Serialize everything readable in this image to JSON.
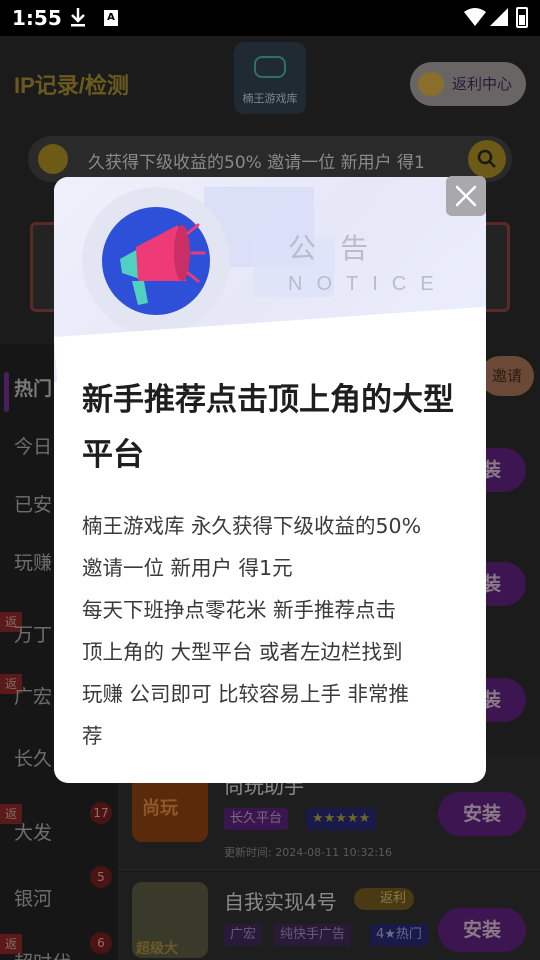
{
  "status_bar": {
    "time": "1:55"
  },
  "header": {
    "title": "IP记录/检测",
    "logo_text": "楠王游戏库",
    "rebate_button": "返利中心"
  },
  "ticker": {
    "text": "久获得下级收益的50% 邀请一位 新用户 得1"
  },
  "sidebar": {
    "items": [
      {
        "label": "热门"
      },
      {
        "label": "今日"
      },
      {
        "label": "已安"
      },
      {
        "label": "玩赚"
      },
      {
        "label": "万丁"
      },
      {
        "label": "广宏"
      },
      {
        "label": "长久"
      },
      {
        "label": "大发"
      },
      {
        "label": "银河"
      },
      {
        "label": "超时代"
      }
    ],
    "fan_tag": "返",
    "counts": [
      "17",
      "5",
      "6"
    ]
  },
  "invite_pill": "邀请",
  "install_label": "安装",
  "cards": [
    {
      "name": "尚玩助手",
      "thumb_text": "尚玩",
      "tags": [
        "长久平台",
        "★★★★★"
      ],
      "updated": "更新时间: 2024-08-11 10:32:16"
    },
    {
      "name": "自我实现4号",
      "fanli_badge": "返利",
      "thumb_text": "超级大",
      "tags": [
        "广宏",
        "纯快手广告",
        "4★热门"
      ]
    }
  ],
  "modal": {
    "notice_cn": "公告",
    "notice_en": "NOTICE",
    "headline": "新手推荐点击顶上角的大型平台",
    "body_lines": [
      "楠王游戏库 永久获得下级收益的50%",
      "邀请一位 新用户 得1元",
      "每天下班挣点零花米 新手推荐点击",
      "顶上角的 大型平台 或者左边栏找到",
      "玩赚 公司即可 比较容易上手 非常推",
      "荐"
    ]
  },
  "colors": {
    "accent_purple": "#7a1fa2",
    "notice_icon_blue": "#2e4fd8",
    "notice_icon_pink": "#ef3a78"
  }
}
